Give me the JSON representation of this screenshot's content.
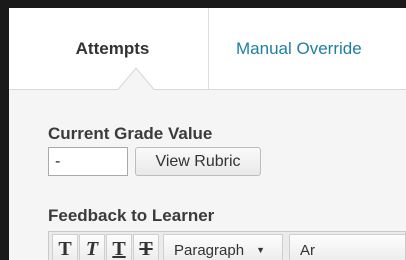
{
  "tabs": [
    {
      "label": "Attempts",
      "active": true
    },
    {
      "label": "Manual Override",
      "active": false
    }
  ],
  "grade": {
    "title": "Current Grade Value",
    "input_value": "-",
    "view_rubric_label": "View Rubric"
  },
  "feedback": {
    "title": "Feedback to Learner"
  },
  "toolbar": {
    "bold": "T",
    "italic": "T",
    "underline": "T",
    "strikethrough": "T",
    "paragraph_select": "Paragraph",
    "font_select_partial": "Ar"
  },
  "colors": {
    "frame": "#1a1a1a",
    "tab_link": "#1e7ea0",
    "content_bg": "#f5f5f5"
  }
}
